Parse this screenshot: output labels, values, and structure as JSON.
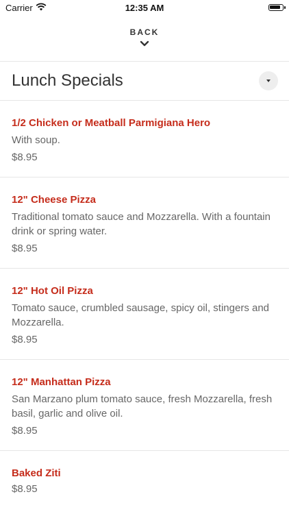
{
  "status_bar": {
    "carrier": "Carrier",
    "time": "12:35 AM",
    "battery_level": 0.9
  },
  "nav": {
    "back_label": "BACK",
    "icons": [
      "wifi-icon",
      "chevron-down-icon",
      "dropdown-triangle-icon"
    ]
  },
  "section": {
    "title": "Lunch Specials"
  },
  "items": [
    {
      "name": "1/2 Chicken or Meatball Parmigiana Hero",
      "description": "With soup.",
      "price": "$8.95"
    },
    {
      "name": "12\" Cheese Pizza",
      "description": "Traditional tomato sauce and Mozzarella. With a fountain drink or spring water.",
      "price": "$8.95"
    },
    {
      "name": "12\" Hot Oil Pizza",
      "description": "Tomato sauce, crumbled sausage, spicy oil, stingers and Mozzarella.",
      "price": "$8.95"
    },
    {
      "name": "12\" Manhattan Pizza",
      "description": "San Marzano plum tomato sauce, fresh Mozzarella, fresh basil, garlic and olive oil.",
      "price": "$8.95"
    },
    {
      "name": "Baked Ziti",
      "description": "",
      "price": "$8.95"
    }
  ],
  "colors": {
    "item_name": "#c52c1b",
    "text_muted": "#666666",
    "divider": "#e6e6e6"
  }
}
